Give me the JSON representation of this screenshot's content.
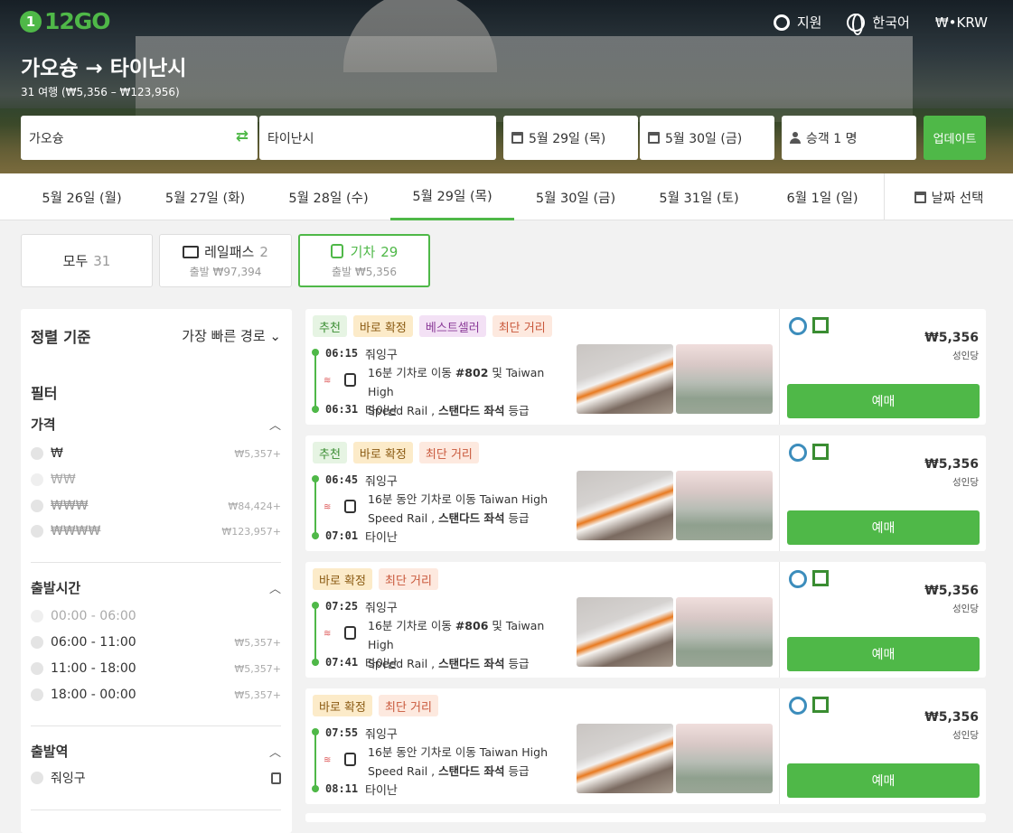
{
  "brand": {
    "logo_mark": "1",
    "logo_text": "12GO",
    "accent": "#4fb848"
  },
  "topnav": {
    "support": "지원",
    "language": "한국어",
    "currency": "₩•KRW"
  },
  "route": {
    "title": "가오슝 → 타이난시",
    "subtitle": "31 여행 (₩5,356 – ₩123,956)"
  },
  "search": {
    "from": "가오슝",
    "to": "타이난시",
    "depart_date": "5월 29일 (목)",
    "return_date": "5월 30일 (금)",
    "passengers": "승객 1 명",
    "update": "업데이트"
  },
  "dates": [
    "5월 26일 (월)",
    "5월 27일 (화)",
    "5월 28일 (수)",
    "5월 29일 (목)",
    "5월 30일 (금)",
    "5월 31일 (토)",
    "6월 1일 (일)"
  ],
  "date_selected": "5월 29일 (목)",
  "date_picker": "날짜 선택",
  "tabs": [
    {
      "label": "모두",
      "count": "31",
      "sub": ""
    },
    {
      "label": "레일패스",
      "count": "2",
      "sub": "출발 ₩97,394"
    },
    {
      "label": "기차",
      "count": "29",
      "sub": "출발 ₩5,356"
    }
  ],
  "sidebar": {
    "sort_label": "정렬 기준",
    "sort_value": "가장 빠른 경로",
    "filter_heading": "필터",
    "price": {
      "heading": "가격",
      "rows": [
        {
          "label": "₩",
          "price": "₩5,357+"
        },
        {
          "label": "₩₩",
          "price": ""
        },
        {
          "label": "₩₩₩",
          "price": "₩84,424+"
        },
        {
          "label": "₩₩₩₩",
          "price": "₩123,957+"
        }
      ]
    },
    "time": {
      "heading": "출발시간",
      "rows": [
        {
          "label": "00:00 - 06:00",
          "price": ""
        },
        {
          "label": "06:00 - 11:00",
          "price": "₩5,357+"
        },
        {
          "label": "11:00 - 18:00",
          "price": "₩5,357+"
        },
        {
          "label": "18:00 - 00:00",
          "price": "₩5,357+"
        }
      ]
    },
    "station": {
      "heading": "출발역",
      "rows": [
        {
          "label": "줘잉구"
        }
      ]
    }
  },
  "trips": [
    {
      "tags": [
        "추천",
        "바로 확정",
        "베스트셀러",
        "최단 거리"
      ],
      "dep_time": "06:15",
      "dep": "줘잉구",
      "desc1_a": "16분 기차로 이동 ",
      "desc1_b": "#802",
      "desc1_c": " 및 Taiwan High",
      "desc2_a": "Speed Rail , ",
      "desc2_b": "스탠다드 좌석",
      "desc2_c": " 등급",
      "arr_time": "06:31",
      "arr": "타이난",
      "price": "₩5,356",
      "per": "성인당",
      "book": "예매"
    },
    {
      "tags": [
        "추천",
        "바로 확정",
        "최단 거리"
      ],
      "dep_time": "06:45",
      "dep": "줘잉구",
      "desc1_a": "16분 동안 기차로 이동 Taiwan High",
      "desc1_b": "",
      "desc1_c": "",
      "desc2_a": "Speed Rail , ",
      "desc2_b": "스탠다드 좌석",
      "desc2_c": " 등급",
      "arr_time": "07:01",
      "arr": "타이난",
      "price": "₩5,356",
      "per": "성인당",
      "book": "예매"
    },
    {
      "tags": [
        "바로 확정",
        "최단 거리"
      ],
      "dep_time": "07:25",
      "dep": "줘잉구",
      "desc1_a": "16분 기차로 이동 ",
      "desc1_b": "#806",
      "desc1_c": " 및 Taiwan High",
      "desc2_a": "Speed Rail , ",
      "desc2_b": "스탠다드 좌석",
      "desc2_c": " 등급",
      "arr_time": "07:41",
      "arr": "타이난",
      "price": "₩5,356",
      "per": "성인당",
      "book": "예매"
    },
    {
      "tags": [
        "바로 확정",
        "최단 거리"
      ],
      "dep_time": "07:55",
      "dep": "줘잉구",
      "desc1_a": "16분 동안 기차로 이동 Taiwan High",
      "desc1_b": "",
      "desc1_c": "",
      "desc2_a": "Speed Rail , ",
      "desc2_b": "스탠다드 좌석",
      "desc2_c": " 등급",
      "arr_time": "08:11",
      "arr": "타이난",
      "price": "₩5,356",
      "per": "성인당",
      "book": "예매"
    }
  ]
}
